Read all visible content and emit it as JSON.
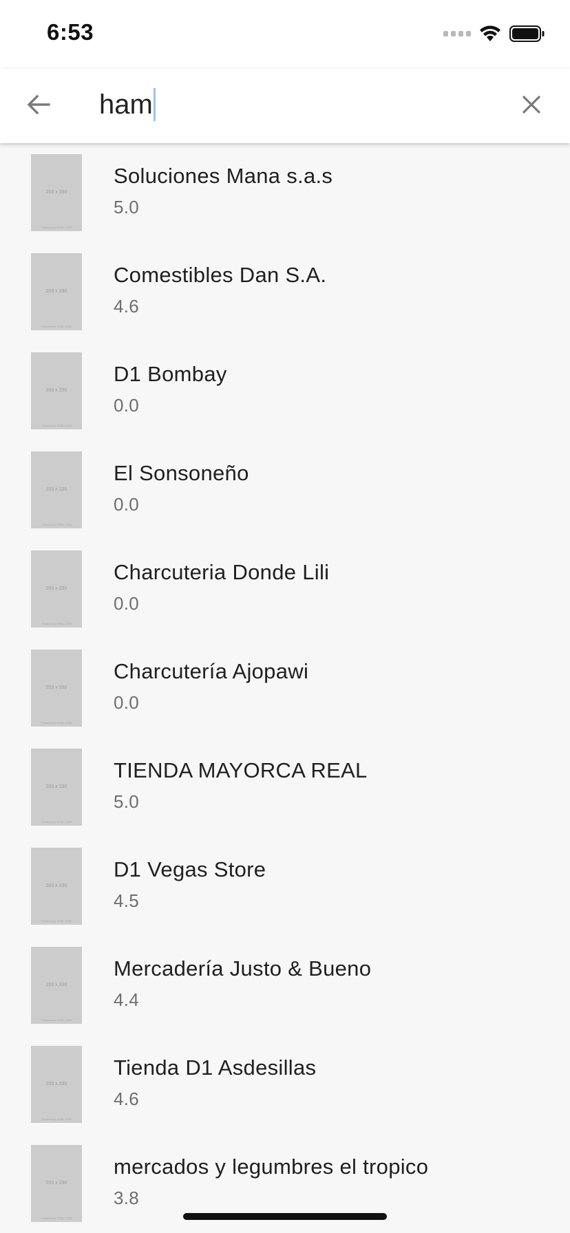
{
  "status_bar": {
    "time": "6:53"
  },
  "search": {
    "query": "ham"
  },
  "results": [
    {
      "name": "Soluciones Mana s.a.s",
      "rating": "5.0"
    },
    {
      "name": "Comestibles Dan S.A.",
      "rating": "4.6"
    },
    {
      "name": "D1 Bombay",
      "rating": "0.0"
    },
    {
      "name": "El Sonsoneño",
      "rating": "0.0"
    },
    {
      "name": "Charcuteria Donde Lili",
      "rating": "0.0"
    },
    {
      "name": "Charcutería Ajopawi",
      "rating": "0.0"
    },
    {
      "name": "TIENDA MAYORCA REAL",
      "rating": "5.0"
    },
    {
      "name": "D1 Vegas Store",
      "rating": "4.5"
    },
    {
      "name": "Mercadería Justo & Bueno",
      "rating": "4.4"
    },
    {
      "name": "Tienda D1 Asdesillas",
      "rating": "4.6"
    },
    {
      "name": "mercados y legumbres el tropico",
      "rating": "3.8"
    }
  ],
  "icons": {
    "back": "arrow-left-icon",
    "clear": "close-icon",
    "wifi": "wifi-icon",
    "battery": "battery-icon",
    "signal": "signal-icon"
  }
}
